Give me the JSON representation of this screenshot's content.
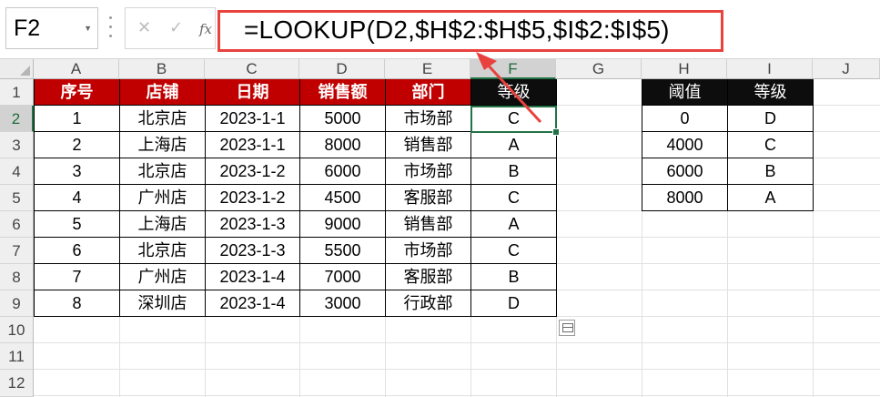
{
  "name_box": {
    "value": "F2"
  },
  "formula_bar": {
    "cancel_glyph": "✕",
    "enter_glyph": "✓",
    "fx_glyph": "fx",
    "formula": "=LOOKUP(D2,$H$2:$H$5,$I$2:$I$5)"
  },
  "columns": [
    "A",
    "B",
    "C",
    "D",
    "E",
    "F",
    "G",
    "H",
    "I",
    "J"
  ],
  "rows": [
    "1",
    "2",
    "3",
    "4",
    "5",
    "6",
    "7",
    "8",
    "9",
    "10",
    "11",
    "12"
  ],
  "main_table": {
    "headers": [
      "序号",
      "店铺",
      "日期",
      "销售额",
      "部门",
      "等级"
    ],
    "rows": [
      [
        "1",
        "北京店",
        "2023-1-1",
        "5000",
        "市场部",
        "C"
      ],
      [
        "2",
        "上海店",
        "2023-1-1",
        "8000",
        "销售部",
        "A"
      ],
      [
        "3",
        "北京店",
        "2023-1-2",
        "6000",
        "市场部",
        "B"
      ],
      [
        "4",
        "广州店",
        "2023-1-2",
        "4500",
        "客服部",
        "C"
      ],
      [
        "5",
        "上海店",
        "2023-1-3",
        "9000",
        "销售部",
        "A"
      ],
      [
        "6",
        "北京店",
        "2023-1-3",
        "5500",
        "市场部",
        "C"
      ],
      [
        "7",
        "广州店",
        "2023-1-4",
        "7000",
        "客服部",
        "B"
      ],
      [
        "8",
        "深圳店",
        "2023-1-4",
        "3000",
        "行政部",
        "D"
      ]
    ]
  },
  "lookup_table": {
    "headers": [
      "阈值",
      "等级"
    ],
    "rows": [
      [
        "0",
        "D"
      ],
      [
        "4000",
        "C"
      ],
      [
        "6000",
        "B"
      ],
      [
        "8000",
        "A"
      ]
    ]
  },
  "colors": {
    "header_red": "#c00000",
    "header_black": "#0d0d0d",
    "selection_green": "#217346",
    "annotation_red": "#e8423f"
  },
  "icons": {
    "quick_analysis": "quick-analysis-icon",
    "annotation": "arrow-annotation"
  }
}
